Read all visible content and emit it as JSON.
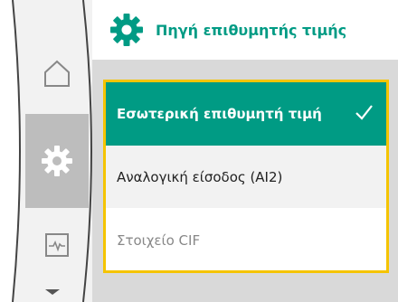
{
  "header": {
    "title": "Πηγή επιθυμητής τιμής",
    "icon": "gear-icon",
    "accent_color": "#009b84"
  },
  "nav": {
    "items": [
      {
        "icon": "home-icon",
        "active": false
      },
      {
        "icon": "gear-icon",
        "active": true
      },
      {
        "icon": "monitor-icon",
        "active": false
      }
    ],
    "more_indicator": "chevron-down-icon"
  },
  "options": [
    {
      "label": "Εσωτερική επιθυμητή τιμή",
      "selected": true,
      "enabled": true
    },
    {
      "label": "Αναλογική είσοδος (AI2)",
      "selected": false,
      "enabled": true
    },
    {
      "label": "Στοιχείο CIF",
      "selected": false,
      "enabled": false
    }
  ],
  "focus_color": "#f5c400"
}
